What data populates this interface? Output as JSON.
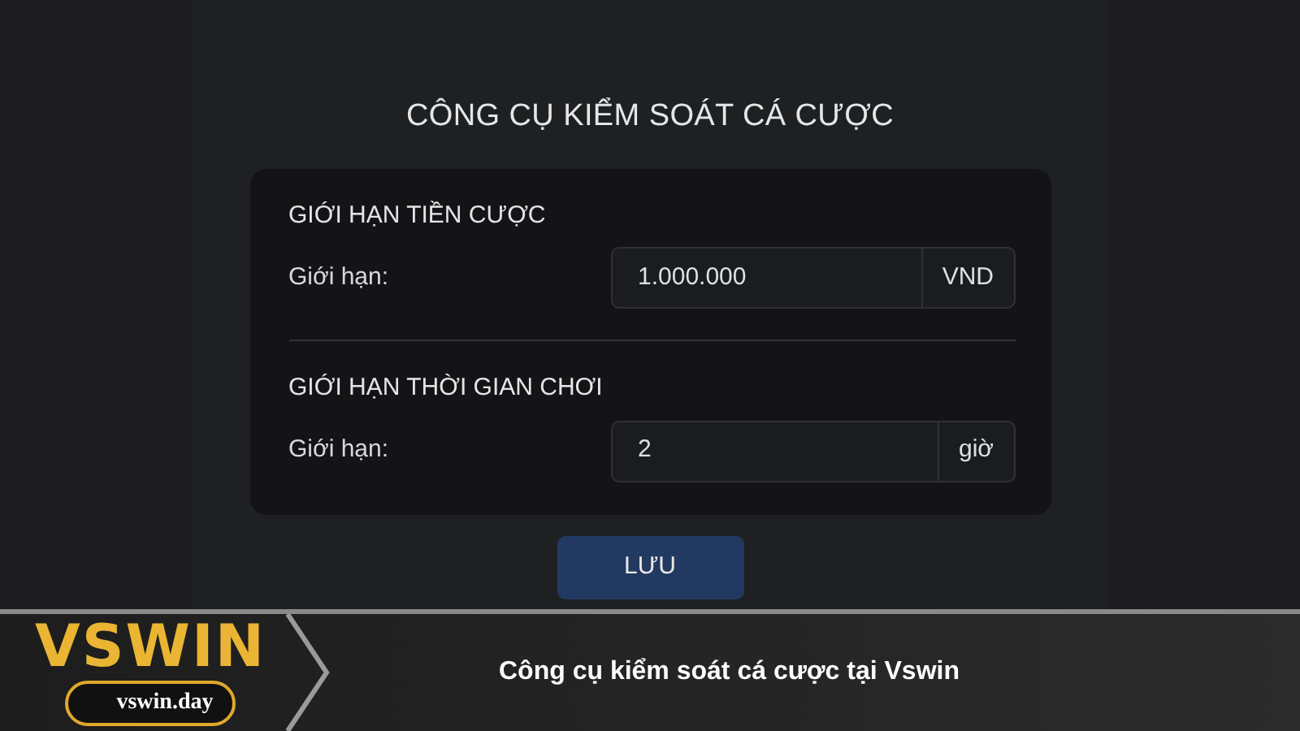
{
  "title": "CÔNG CỤ KIỂM SOÁT CÁ CƯỢC",
  "sections": [
    {
      "heading": "GIỚI HẠN TIỀN CƯỢC",
      "label": "Giới hạn:",
      "value": "1.000.000",
      "unit": "VND"
    },
    {
      "heading": "GIỚI HẠN THỜI GIAN CHƠI",
      "label": "Giới hạn:",
      "value": "2",
      "unit": "giờ"
    }
  ],
  "save_button": "LƯU",
  "banner": {
    "logo": "VSWIN",
    "domain": "vswin.day",
    "caption": "Công cụ kiểm soát cá cược tại Vswin"
  }
}
